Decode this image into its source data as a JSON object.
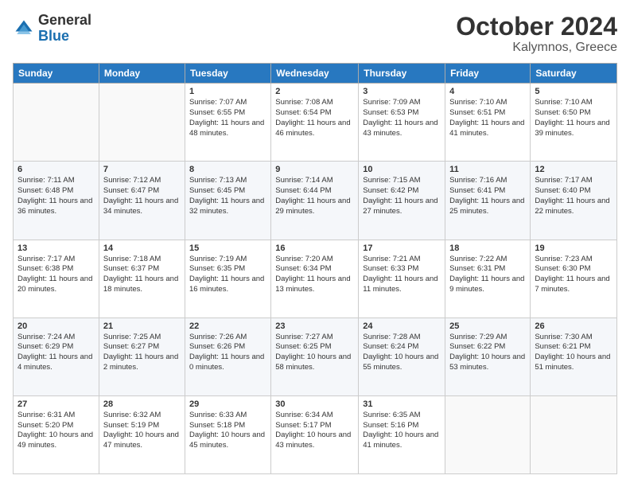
{
  "logo": {
    "general": "General",
    "blue": "Blue"
  },
  "header": {
    "month": "October 2024",
    "location": "Kalymnos, Greece"
  },
  "weekdays": [
    "Sunday",
    "Monday",
    "Tuesday",
    "Wednesday",
    "Thursday",
    "Friday",
    "Saturday"
  ],
  "weeks": [
    [
      {
        "day": "",
        "info": ""
      },
      {
        "day": "",
        "info": ""
      },
      {
        "day": "1",
        "info": "Sunrise: 7:07 AM\nSunset: 6:55 PM\nDaylight: 11 hours and 48 minutes."
      },
      {
        "day": "2",
        "info": "Sunrise: 7:08 AM\nSunset: 6:54 PM\nDaylight: 11 hours and 46 minutes."
      },
      {
        "day": "3",
        "info": "Sunrise: 7:09 AM\nSunset: 6:53 PM\nDaylight: 11 hours and 43 minutes."
      },
      {
        "day": "4",
        "info": "Sunrise: 7:10 AM\nSunset: 6:51 PM\nDaylight: 11 hours and 41 minutes."
      },
      {
        "day": "5",
        "info": "Sunrise: 7:10 AM\nSunset: 6:50 PM\nDaylight: 11 hours and 39 minutes."
      }
    ],
    [
      {
        "day": "6",
        "info": "Sunrise: 7:11 AM\nSunset: 6:48 PM\nDaylight: 11 hours and 36 minutes."
      },
      {
        "day": "7",
        "info": "Sunrise: 7:12 AM\nSunset: 6:47 PM\nDaylight: 11 hours and 34 minutes."
      },
      {
        "day": "8",
        "info": "Sunrise: 7:13 AM\nSunset: 6:45 PM\nDaylight: 11 hours and 32 minutes."
      },
      {
        "day": "9",
        "info": "Sunrise: 7:14 AM\nSunset: 6:44 PM\nDaylight: 11 hours and 29 minutes."
      },
      {
        "day": "10",
        "info": "Sunrise: 7:15 AM\nSunset: 6:42 PM\nDaylight: 11 hours and 27 minutes."
      },
      {
        "day": "11",
        "info": "Sunrise: 7:16 AM\nSunset: 6:41 PM\nDaylight: 11 hours and 25 minutes."
      },
      {
        "day": "12",
        "info": "Sunrise: 7:17 AM\nSunset: 6:40 PM\nDaylight: 11 hours and 22 minutes."
      }
    ],
    [
      {
        "day": "13",
        "info": "Sunrise: 7:17 AM\nSunset: 6:38 PM\nDaylight: 11 hours and 20 minutes."
      },
      {
        "day": "14",
        "info": "Sunrise: 7:18 AM\nSunset: 6:37 PM\nDaylight: 11 hours and 18 minutes."
      },
      {
        "day": "15",
        "info": "Sunrise: 7:19 AM\nSunset: 6:35 PM\nDaylight: 11 hours and 16 minutes."
      },
      {
        "day": "16",
        "info": "Sunrise: 7:20 AM\nSunset: 6:34 PM\nDaylight: 11 hours and 13 minutes."
      },
      {
        "day": "17",
        "info": "Sunrise: 7:21 AM\nSunset: 6:33 PM\nDaylight: 11 hours and 11 minutes."
      },
      {
        "day": "18",
        "info": "Sunrise: 7:22 AM\nSunset: 6:31 PM\nDaylight: 11 hours and 9 minutes."
      },
      {
        "day": "19",
        "info": "Sunrise: 7:23 AM\nSunset: 6:30 PM\nDaylight: 11 hours and 7 minutes."
      }
    ],
    [
      {
        "day": "20",
        "info": "Sunrise: 7:24 AM\nSunset: 6:29 PM\nDaylight: 11 hours and 4 minutes."
      },
      {
        "day": "21",
        "info": "Sunrise: 7:25 AM\nSunset: 6:27 PM\nDaylight: 11 hours and 2 minutes."
      },
      {
        "day": "22",
        "info": "Sunrise: 7:26 AM\nSunset: 6:26 PM\nDaylight: 11 hours and 0 minutes."
      },
      {
        "day": "23",
        "info": "Sunrise: 7:27 AM\nSunset: 6:25 PM\nDaylight: 10 hours and 58 minutes."
      },
      {
        "day": "24",
        "info": "Sunrise: 7:28 AM\nSunset: 6:24 PM\nDaylight: 10 hours and 55 minutes."
      },
      {
        "day": "25",
        "info": "Sunrise: 7:29 AM\nSunset: 6:22 PM\nDaylight: 10 hours and 53 minutes."
      },
      {
        "day": "26",
        "info": "Sunrise: 7:30 AM\nSunset: 6:21 PM\nDaylight: 10 hours and 51 minutes."
      }
    ],
    [
      {
        "day": "27",
        "info": "Sunrise: 6:31 AM\nSunset: 5:20 PM\nDaylight: 10 hours and 49 minutes."
      },
      {
        "day": "28",
        "info": "Sunrise: 6:32 AM\nSunset: 5:19 PM\nDaylight: 10 hours and 47 minutes."
      },
      {
        "day": "29",
        "info": "Sunrise: 6:33 AM\nSunset: 5:18 PM\nDaylight: 10 hours and 45 minutes."
      },
      {
        "day": "30",
        "info": "Sunrise: 6:34 AM\nSunset: 5:17 PM\nDaylight: 10 hours and 43 minutes."
      },
      {
        "day": "31",
        "info": "Sunrise: 6:35 AM\nSunset: 5:16 PM\nDaylight: 10 hours and 41 minutes."
      },
      {
        "day": "",
        "info": ""
      },
      {
        "day": "",
        "info": ""
      }
    ]
  ]
}
